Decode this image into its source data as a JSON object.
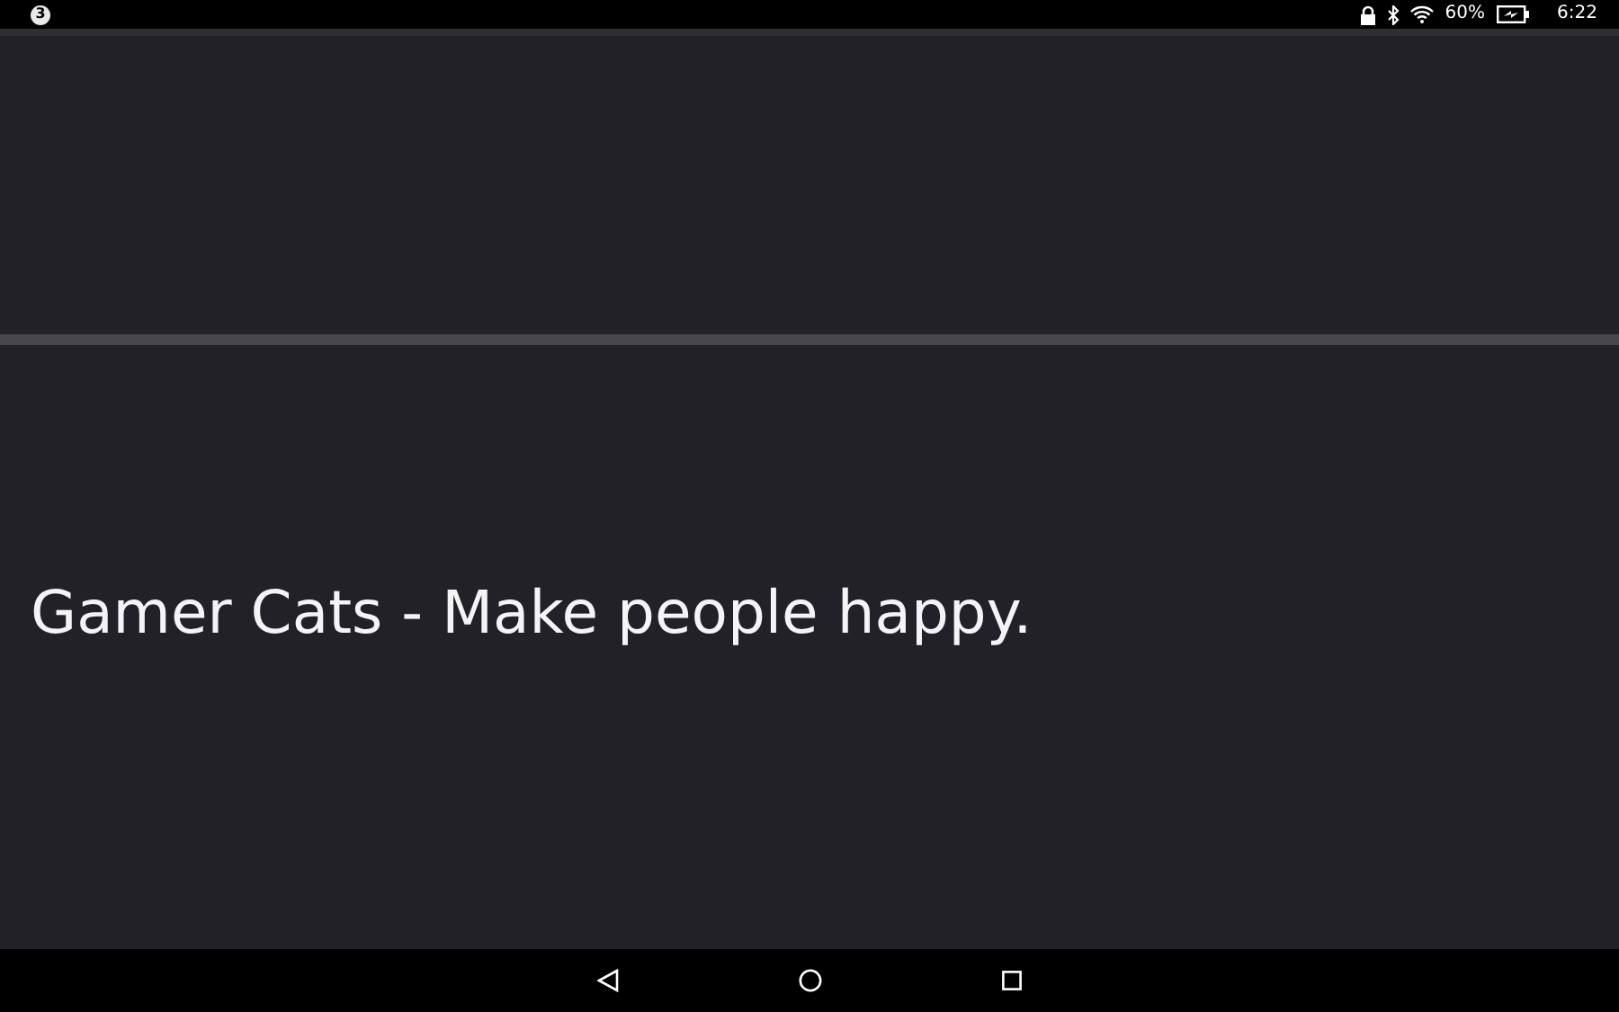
{
  "status_bar": {
    "notification_count": "3",
    "battery_percent": "60%",
    "time": "6:22"
  },
  "message": {
    "text": "Gamer Cats - Make people happy."
  }
}
